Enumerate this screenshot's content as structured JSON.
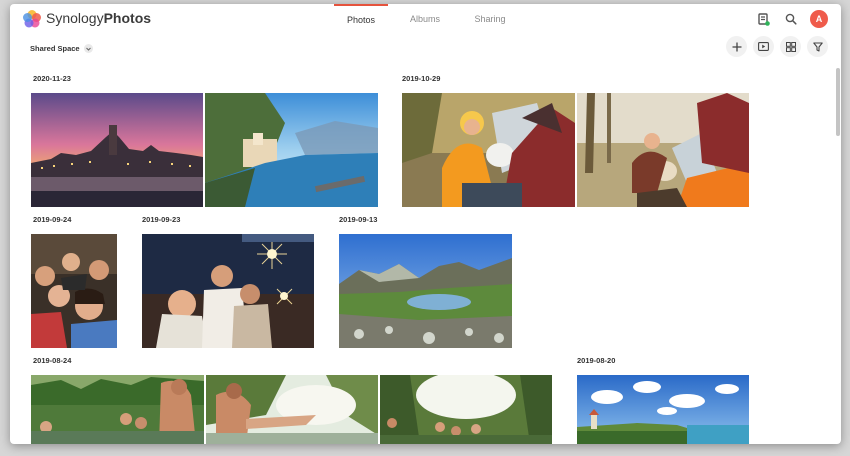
{
  "app": {
    "brand_part1": "Synology",
    "brand_part2": "Photos",
    "accent": "#e5533d"
  },
  "nav": {
    "tabs": [
      {
        "label": "Photos",
        "active": true
      },
      {
        "label": "Albums",
        "active": false
      },
      {
        "label": "Sharing",
        "active": false
      }
    ]
  },
  "header": {
    "avatar_initial": "A",
    "icons": [
      "task-icon",
      "search-icon"
    ]
  },
  "toolbar": {
    "space_label": "Shared Space",
    "icons": [
      "add-icon",
      "slideshow-icon",
      "grid-view-icon",
      "filter-icon"
    ]
  },
  "timeline": {
    "groups": [
      {
        "date": "2020-11-23",
        "photos": [
          "Dresden skyline at sunset",
          "Amalfi coast village"
        ]
      },
      {
        "date": "2019-10-29",
        "photos": [
          "Couple camping with dog",
          "Camping by tent with dog"
        ]
      },
      {
        "date": "2019-09-24",
        "photos": [
          "Friends selfie"
        ]
      },
      {
        "date": "2019-09-23",
        "photos": [
          "Friends with sparklers"
        ]
      },
      {
        "date": "2019-09-13",
        "photos": [
          "Mountain lake"
        ]
      },
      {
        "date": "2019-08-24",
        "photos": [
          "Friends at river",
          "Friends swimming",
          "Friends in forest"
        ]
      },
      {
        "date": "2019-08-20",
        "photos": [
          "Coastal lighthouse"
        ]
      }
    ]
  }
}
